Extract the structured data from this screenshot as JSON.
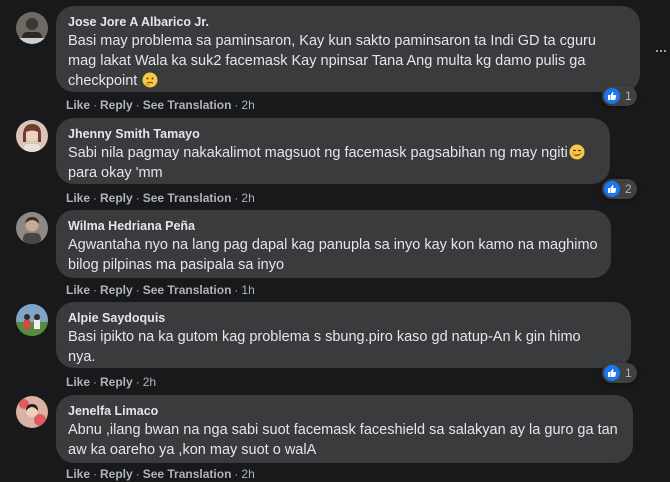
{
  "actions": {
    "like": "Like",
    "reply": "Reply",
    "see_translation": "See Translation",
    "separator": "·"
  },
  "comments": [
    {
      "author": "Jose Jore A Albarico Jr.",
      "line1": "Basi may problema sa paminsaron, Kay kun sakto paminsaron ta Indi GD ta cguru",
      "line2": "mag lakat Wala ka suk2 facemask Kay npinsar Tana Ang multa kg damo pulis ga",
      "line3": "checkpoint",
      "emoji": "thinking-face",
      "time": "2h",
      "has_translation": true,
      "reactions": "1"
    },
    {
      "author": "Jhenny Smith Tamayo",
      "line1": "Sabi nila pagmay nakakalimot magsuot ng facemask pagsabihan ng may ngiti",
      "line2": "para okay 'mm",
      "emoji": "smirking-face",
      "time": "2h",
      "has_translation": true,
      "reactions": "2"
    },
    {
      "author": "Wilma Hedriana Peña",
      "line1": "Agwantaha nyo na lang pag dapal kag panupla sa inyo kay kon kamo na maghimo",
      "line2": "bilog pilpinas ma pasipala sa inyo",
      "time": "1h",
      "has_translation": true
    },
    {
      "author": "Alpie Saydoquis",
      "line1": "Basi ipikto na ka gutom kag problema s sbung.piro kaso gd natup-An k gin himo",
      "line2": "nya.",
      "time": "2h",
      "has_translation": false,
      "reactions": "1"
    },
    {
      "author": "Jenelfa Limaco",
      "line1": "Abnu ,ilang bwan na nga sabi suot facemask faceshield sa salakyan ay la guro ga tan",
      "line2": "aw ka oareho ya ,kon may suot o walA",
      "time": "2h",
      "has_translation": true
    }
  ],
  "colors": {
    "background": "#18191a",
    "bubble": "#3a3b3c",
    "text": "#e4e6eb",
    "secondary": "#b0b3b8",
    "like_blue": "#1877f2"
  }
}
